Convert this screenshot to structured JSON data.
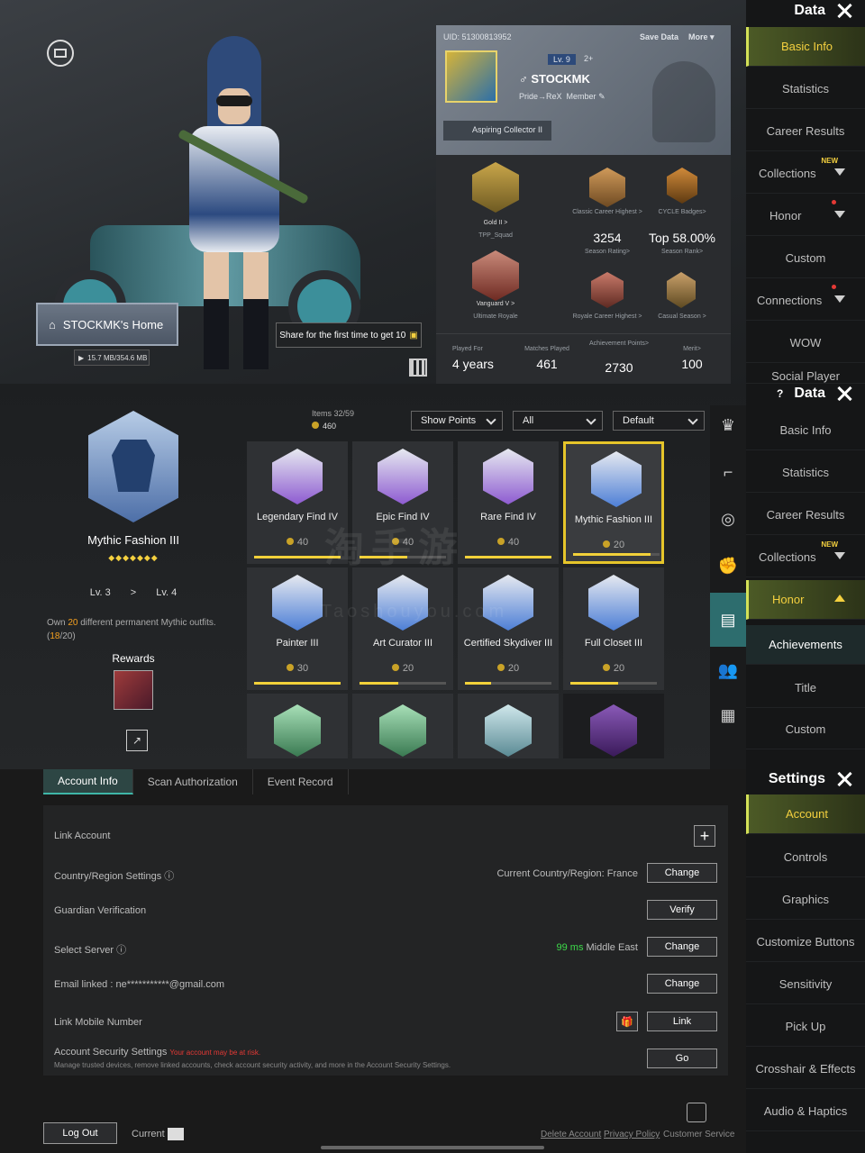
{
  "panel1": {
    "header": "Data",
    "uid": "UID: 51300813952",
    "save_data": "Save Data",
    "more": "More",
    "level": "Lv. 9",
    "friends": "2+",
    "name": "STOCKMK",
    "clan": "Pride→ReX",
    "member": "Member",
    "title_badge": "Aspiring Collector II",
    "home_label": "STOCKMK's Home",
    "home_size": "15.7 MB/354.6 MB",
    "share_text": "Share for the first time to get 10",
    "rank_left_top_label": "Gold II >",
    "rank_left_top_sub": "TPP_Squad",
    "rank_left_bottom_label": "Vanguard V >",
    "rank_left_bottom_sub": "Ultimate Royale",
    "classic_highest": "Classic Career Highest >",
    "cycle_badges": "CYCLE Badges>",
    "season_rating_value": "3254",
    "season_rating_label": "Season Rating>",
    "season_rank_value": "Top 58.00%",
    "season_rank_label": "Season Rank>",
    "royale_highest": "Royale Career Highest >",
    "casual_season": "Casual Season >",
    "played_for_label": "Played For",
    "played_for_value": "4 years",
    "matches_label": "Matches Played",
    "matches_value": "461",
    "achievement_label": "Achievement Points>",
    "achievement_value": "2730",
    "merit_label": "Merit>",
    "merit_value": "100",
    "rail": [
      "Basic Info",
      "Statistics",
      "Career Results",
      "Collections",
      "Honor",
      "Custom",
      "Connections",
      "WOW",
      "Social Player"
    ],
    "new_tag": "NEW"
  },
  "panel2": {
    "header": "Data",
    "items_label": "Items  32/59",
    "points": "460",
    "filter_points": "Show Points",
    "filter_all": "All",
    "filter_sort": "Default",
    "featured_name": "Mythic Fashion III",
    "stars": "◆◆◆◆◆◆◆",
    "lv_from": "Lv. 3",
    "lv_to": "Lv. 4",
    "desc_pre": "Own",
    "desc_num": "20",
    "desc_post": "different permanent Mythic outfits.",
    "progress_open": "(",
    "progress_num": "18",
    "progress_close": "/20)",
    "rewards": "Rewards",
    "tiles": [
      {
        "name": "Legendary Find IV",
        "pts": "40",
        "fill": 1.0,
        "color": "#8e5bd1"
      },
      {
        "name": "Epic Find IV",
        "pts": "40",
        "fill": 0.55,
        "color": "#8e5bd1"
      },
      {
        "name": "Rare Find IV",
        "pts": "40",
        "fill": 1.0,
        "color": "#8e5bd1"
      },
      {
        "name": "Mythic Fashion III",
        "pts": "20",
        "fill": 0.9,
        "color": "#4d7fd6"
      },
      {
        "name": "Painter III",
        "pts": "30",
        "fill": 1.0,
        "color": "#4d7fd6"
      },
      {
        "name": "Art Curator III",
        "pts": "20",
        "fill": 0.45,
        "color": "#4d7fd6"
      },
      {
        "name": "Certified Skydiver III",
        "pts": "20",
        "fill": 0.3,
        "color": "#4d7fd6"
      },
      {
        "name": "Full Closet III",
        "pts": "20",
        "fill": 0.55,
        "color": "#4d7fd6"
      }
    ],
    "rail": [
      "Basic Info",
      "Statistics",
      "Career Results",
      "Collections",
      "Honor",
      "Achievements",
      "Title",
      "Custom"
    ],
    "new_tag": "NEW",
    "watermark": "淘手游",
    "watermark_url": "Taoshouyou.com"
  },
  "panel3": {
    "header": "Settings",
    "tabs": [
      "Account Info",
      "Scan Authorization",
      "Event Record"
    ],
    "rows": {
      "link_account": "Link Account",
      "country": "Country/Region Settings",
      "country_value": "Current Country/Region: France",
      "guardian": "Guardian Verification",
      "server": "Select Server",
      "server_ping": "99 ms",
      "server_value": "Middle East",
      "email": "Email linked : ne***********@gmail.com",
      "mobile": "Link Mobile Number",
      "security": "Account Security Settings",
      "security_warn": "Your account may be at risk.",
      "security_desc": "Manage trusted devices, remove linked accounts, check account security activity, and more in the Account Security Settings."
    },
    "buttons": {
      "change": "Change",
      "verify": "Verify",
      "link": "Link",
      "go": "Go",
      "plus": "+"
    },
    "footer": {
      "logout": "Log Out",
      "current": "Current",
      "delete": "Delete Account",
      "privacy": "Privacy Policy",
      "service": "Customer Service"
    },
    "rail": [
      "Account",
      "Controls",
      "Graphics",
      "Customize Buttons",
      "Sensitivity",
      "Pick Up",
      "Crosshair & Effects",
      "Audio & Haptics"
    ]
  },
  "colors": {
    "accent": "#f4d03f",
    "teal": "#2d6d6e",
    "ping": "#3ddc4a",
    "warn": "#e53935"
  }
}
